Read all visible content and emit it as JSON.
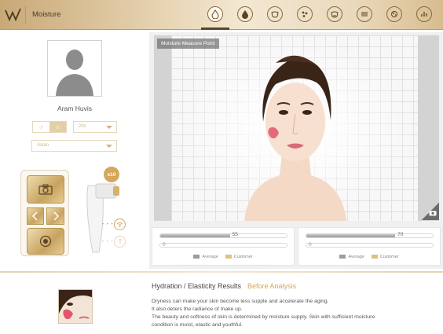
{
  "app": {
    "title": "Moisture"
  },
  "toolbar": {
    "tools": [
      "moisture-outline-icon",
      "moisture-filled-icon",
      "face-icon",
      "pores-icon",
      "face-color-icon",
      "lines-icon",
      "spots-icon",
      "chart-icon"
    ],
    "active_index": 0
  },
  "user": {
    "name": "Aram Huvis",
    "gender_male": "♂",
    "gender_female": "♀",
    "age_placeholder": "20s",
    "region_placeholder": "Asian"
  },
  "device": {
    "zoom": "x10"
  },
  "viewer": {
    "label": "Moisture Measure Point"
  },
  "measurements": {
    "left": {
      "average": 55,
      "customer": 0
    },
    "right": {
      "average": 70,
      "customer": 0
    }
  },
  "legend": {
    "average": "Average",
    "customer": "Customer"
  },
  "results": {
    "title": "Hydration / Elasticity Results",
    "subtitle": "Before Analysis",
    "lines": [
      "Dryness can make your skin become less supple and accelerate the aging.",
      "It also deters the radiance of make up.",
      "The beauty and softness of skin is determined by moisture supply. Skin with sufficient moisture",
      "condition is moist, elastic and youthful."
    ]
  },
  "colors": {
    "accent": "#d4a75c",
    "header": "#e6d2b0"
  }
}
